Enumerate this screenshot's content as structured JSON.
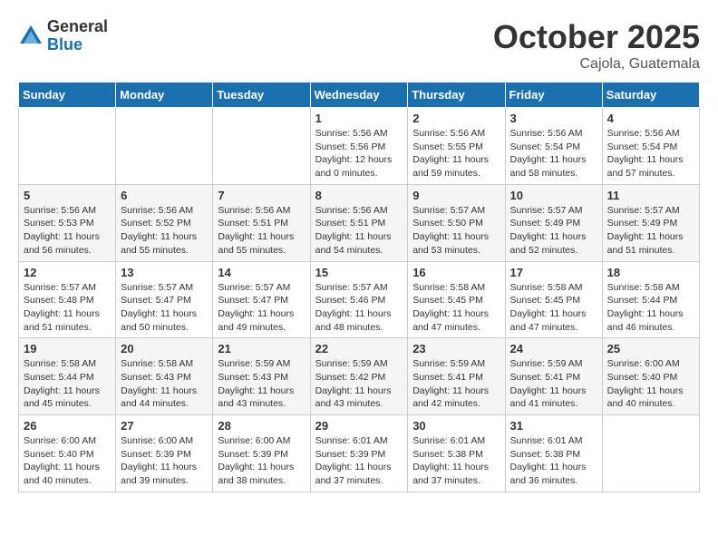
{
  "header": {
    "logo_general": "General",
    "logo_blue": "Blue",
    "month_title": "October 2025",
    "location": "Cajola, Guatemala"
  },
  "weekdays": [
    "Sunday",
    "Monday",
    "Tuesday",
    "Wednesday",
    "Thursday",
    "Friday",
    "Saturday"
  ],
  "weeks": [
    [
      {
        "day": "",
        "info": ""
      },
      {
        "day": "",
        "info": ""
      },
      {
        "day": "",
        "info": ""
      },
      {
        "day": "1",
        "info": "Sunrise: 5:56 AM\nSunset: 5:56 PM\nDaylight: 12 hours\nand 0 minutes."
      },
      {
        "day": "2",
        "info": "Sunrise: 5:56 AM\nSunset: 5:55 PM\nDaylight: 11 hours\nand 59 minutes."
      },
      {
        "day": "3",
        "info": "Sunrise: 5:56 AM\nSunset: 5:54 PM\nDaylight: 11 hours\nand 58 minutes."
      },
      {
        "day": "4",
        "info": "Sunrise: 5:56 AM\nSunset: 5:54 PM\nDaylight: 11 hours\nand 57 minutes."
      }
    ],
    [
      {
        "day": "5",
        "info": "Sunrise: 5:56 AM\nSunset: 5:53 PM\nDaylight: 11 hours\nand 56 minutes."
      },
      {
        "day": "6",
        "info": "Sunrise: 5:56 AM\nSunset: 5:52 PM\nDaylight: 11 hours\nand 55 minutes."
      },
      {
        "day": "7",
        "info": "Sunrise: 5:56 AM\nSunset: 5:51 PM\nDaylight: 11 hours\nand 55 minutes."
      },
      {
        "day": "8",
        "info": "Sunrise: 5:56 AM\nSunset: 5:51 PM\nDaylight: 11 hours\nand 54 minutes."
      },
      {
        "day": "9",
        "info": "Sunrise: 5:57 AM\nSunset: 5:50 PM\nDaylight: 11 hours\nand 53 minutes."
      },
      {
        "day": "10",
        "info": "Sunrise: 5:57 AM\nSunset: 5:49 PM\nDaylight: 11 hours\nand 52 minutes."
      },
      {
        "day": "11",
        "info": "Sunrise: 5:57 AM\nSunset: 5:49 PM\nDaylight: 11 hours\nand 51 minutes."
      }
    ],
    [
      {
        "day": "12",
        "info": "Sunrise: 5:57 AM\nSunset: 5:48 PM\nDaylight: 11 hours\nand 51 minutes."
      },
      {
        "day": "13",
        "info": "Sunrise: 5:57 AM\nSunset: 5:47 PM\nDaylight: 11 hours\nand 50 minutes."
      },
      {
        "day": "14",
        "info": "Sunrise: 5:57 AM\nSunset: 5:47 PM\nDaylight: 11 hours\nand 49 minutes."
      },
      {
        "day": "15",
        "info": "Sunrise: 5:57 AM\nSunset: 5:46 PM\nDaylight: 11 hours\nand 48 minutes."
      },
      {
        "day": "16",
        "info": "Sunrise: 5:58 AM\nSunset: 5:45 PM\nDaylight: 11 hours\nand 47 minutes."
      },
      {
        "day": "17",
        "info": "Sunrise: 5:58 AM\nSunset: 5:45 PM\nDaylight: 11 hours\nand 47 minutes."
      },
      {
        "day": "18",
        "info": "Sunrise: 5:58 AM\nSunset: 5:44 PM\nDaylight: 11 hours\nand 46 minutes."
      }
    ],
    [
      {
        "day": "19",
        "info": "Sunrise: 5:58 AM\nSunset: 5:44 PM\nDaylight: 11 hours\nand 45 minutes."
      },
      {
        "day": "20",
        "info": "Sunrise: 5:58 AM\nSunset: 5:43 PM\nDaylight: 11 hours\nand 44 minutes."
      },
      {
        "day": "21",
        "info": "Sunrise: 5:59 AM\nSunset: 5:43 PM\nDaylight: 11 hours\nand 43 minutes."
      },
      {
        "day": "22",
        "info": "Sunrise: 5:59 AM\nSunset: 5:42 PM\nDaylight: 11 hours\nand 43 minutes."
      },
      {
        "day": "23",
        "info": "Sunrise: 5:59 AM\nSunset: 5:41 PM\nDaylight: 11 hours\nand 42 minutes."
      },
      {
        "day": "24",
        "info": "Sunrise: 5:59 AM\nSunset: 5:41 PM\nDaylight: 11 hours\nand 41 minutes."
      },
      {
        "day": "25",
        "info": "Sunrise: 6:00 AM\nSunset: 5:40 PM\nDaylight: 11 hours\nand 40 minutes."
      }
    ],
    [
      {
        "day": "26",
        "info": "Sunrise: 6:00 AM\nSunset: 5:40 PM\nDaylight: 11 hours\nand 40 minutes."
      },
      {
        "day": "27",
        "info": "Sunrise: 6:00 AM\nSunset: 5:39 PM\nDaylight: 11 hours\nand 39 minutes."
      },
      {
        "day": "28",
        "info": "Sunrise: 6:00 AM\nSunset: 5:39 PM\nDaylight: 11 hours\nand 38 minutes."
      },
      {
        "day": "29",
        "info": "Sunrise: 6:01 AM\nSunset: 5:39 PM\nDaylight: 11 hours\nand 37 minutes."
      },
      {
        "day": "30",
        "info": "Sunrise: 6:01 AM\nSunset: 5:38 PM\nDaylight: 11 hours\nand 37 minutes."
      },
      {
        "day": "31",
        "info": "Sunrise: 6:01 AM\nSunset: 5:38 PM\nDaylight: 11 hours\nand 36 minutes."
      },
      {
        "day": "",
        "info": ""
      }
    ]
  ]
}
